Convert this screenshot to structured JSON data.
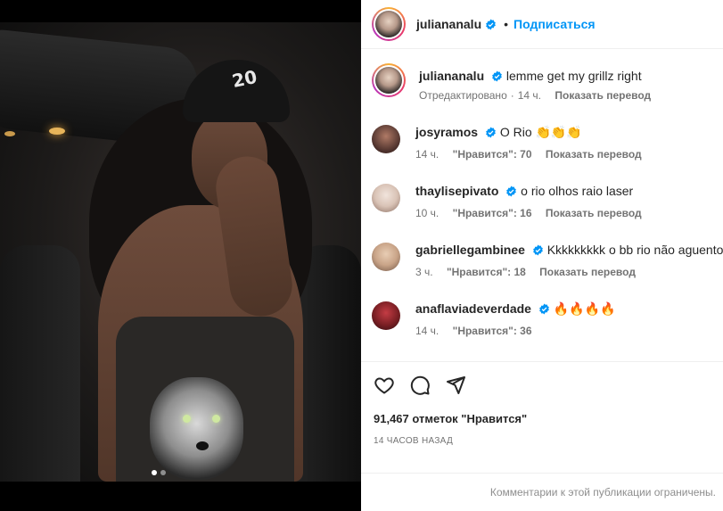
{
  "post": {
    "author": "juliananalu",
    "follow_label": "Подписаться",
    "separator": "•"
  },
  "caption": {
    "username": "juliananalu",
    "text": "lemme get my grillz right",
    "edited": "Отредактировано",
    "time": "14 ч.",
    "translate": "Показать перевод"
  },
  "comments": [
    {
      "username": "josyramos",
      "text": "O Rio 👏👏👏",
      "time": "14 ч.",
      "likes": "\"Нравится\": 70",
      "translate": "Показать перевод",
      "avatar_color": "#4a2f2a"
    },
    {
      "username": "thaylisepivato",
      "text": "o rio olhos raio laser",
      "time": "10 ч.",
      "likes": "\"Нравится\": 16",
      "translate": "Показать перевод",
      "avatar_color": "#d9c3b6"
    },
    {
      "username": "gabriellegambinee",
      "text": "Kkkkkkkkk o bb rio não aguento",
      "time": "3 ч.",
      "likes": "\"Нравится\": 18",
      "translate": "Показать перевод",
      "avatar_color": "#c9a488"
    },
    {
      "username": "anaflaviadeverdade",
      "text": "🔥🔥🔥🔥",
      "time": "14 ч.",
      "likes": "\"Нравится\": 36",
      "translate": "",
      "avatar_color": "#7a1f24"
    }
  ],
  "actions": {
    "like_icon": "heart-icon",
    "comment_icon": "comment-icon",
    "share_icon": "share-icon"
  },
  "likes_text": "91,467 отметок \"Нравится\"",
  "posted_time": "14 ЧАСОВ НАЗАД",
  "footer_text": "Комментарии к этой публикации ограничены.",
  "media": {
    "cap_text": "20",
    "carousel_dots": 2,
    "active_dot": 1
  },
  "colors": {
    "accent": "#0095f6",
    "verified": "#0095f6",
    "muted": "#737373"
  }
}
